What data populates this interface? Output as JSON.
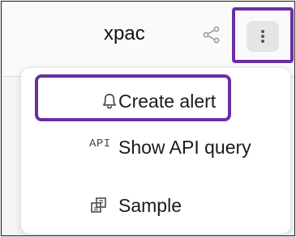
{
  "header": {
    "title": "xpac"
  },
  "menu": {
    "items": [
      {
        "label": "Create alert",
        "icon": "bell-icon"
      },
      {
        "label": "Show API query",
        "icon": "api-icon",
        "icon_text": "API"
      },
      {
        "label": "Sample",
        "icon": "sample-icon"
      }
    ]
  },
  "colors": {
    "highlight": "#6b2fa3",
    "menu_bg": "#ffffff",
    "button_bg": "#e5e5e5"
  }
}
